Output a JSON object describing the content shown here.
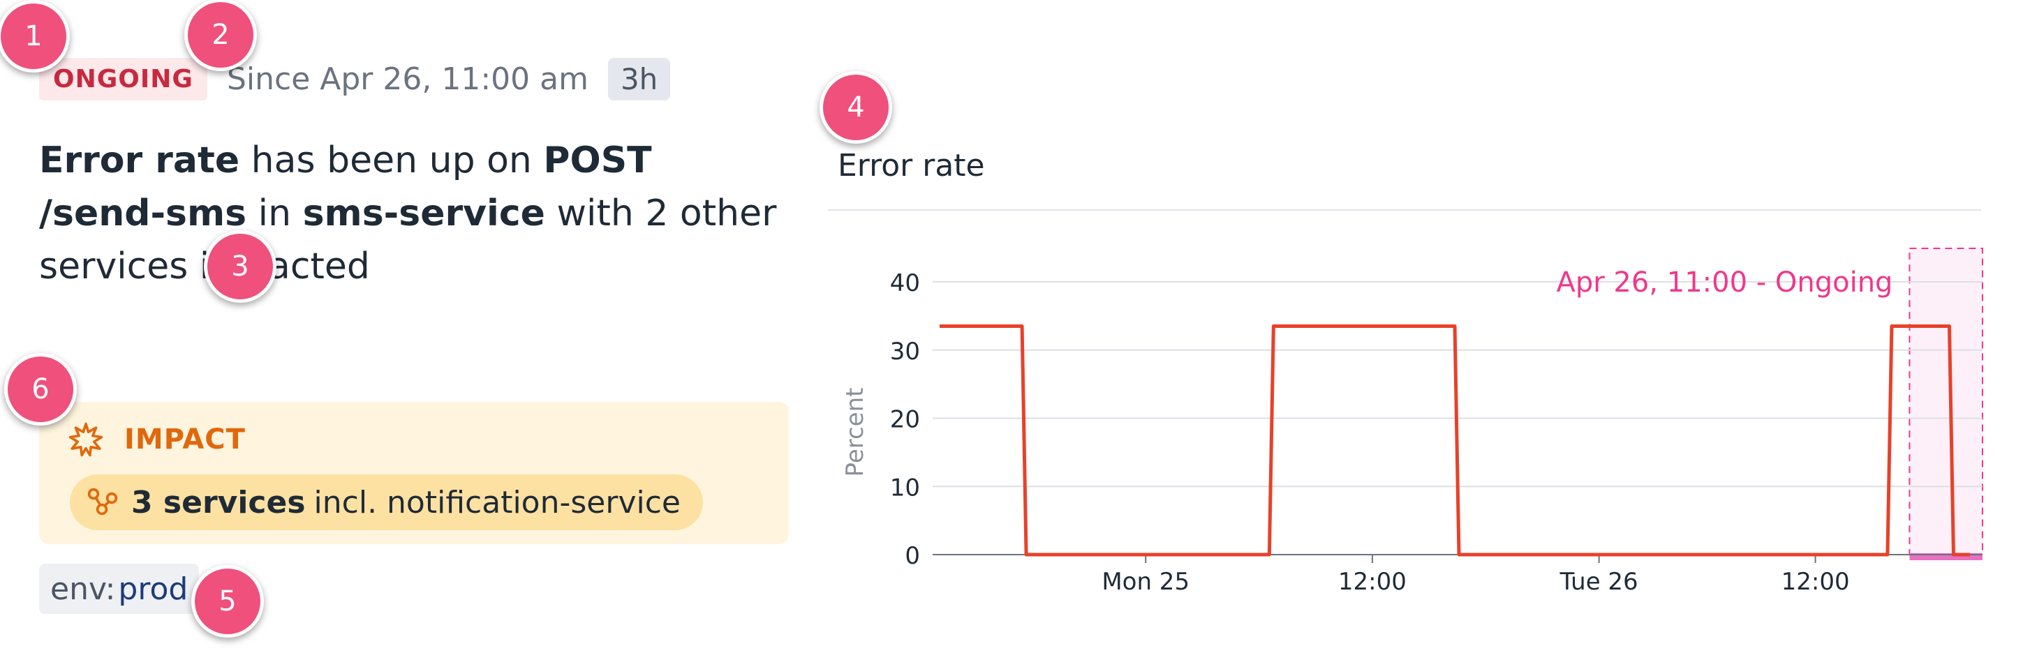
{
  "incident": {
    "status": "ONGOING",
    "since": "Since Apr 26, 11:00 am",
    "duration": "3h",
    "headline": {
      "metric": "Error rate",
      "t1": " has been up on ",
      "endpoint": "POST /send-sms",
      "t2": " in ",
      "service": "sms-service",
      "t3": " with 2 other services impacted"
    }
  },
  "impact": {
    "title": "IMPACT",
    "icon": "explosion-icon",
    "services_count": "3 services",
    "services_detail": "incl. notification-service"
  },
  "env_tag": {
    "key": "env:",
    "value": "prod"
  },
  "callouts": [
    "1",
    "2",
    "3",
    "4",
    "5",
    "6"
  ],
  "colors": {
    "series": "#e8412a",
    "annotation": "#f0378c",
    "badge": "#c8293f",
    "impact": "#e0680c"
  },
  "chart_data": {
    "type": "line",
    "title": "Error rate",
    "ylabel": "Percent",
    "ylim": [
      0,
      40
    ],
    "yticks": [
      0,
      10,
      20,
      30,
      40
    ],
    "xticks": [
      "Mon 25",
      "12:00",
      "Tue 26",
      "12:00"
    ],
    "annotation": "Apr 26, 11:00 - Ongoing",
    "grid": true,
    "series": [
      {
        "values": [
          33.5,
          33.5,
          33.5,
          33.5,
          33.5,
          0,
          0,
          0,
          0,
          0,
          0,
          0,
          0,
          0,
          0,
          0,
          0,
          33.5,
          33.5,
          33.5,
          33.5,
          33.5,
          33.5,
          33.5,
          33.5,
          33.5,
          0,
          0,
          0,
          0,
          0,
          0,
          0,
          0,
          0,
          0,
          0,
          0,
          0,
          0,
          0,
          0,
          0,
          0,
          0,
          0,
          0,
          33.5,
          33.5,
          33.5,
          0
        ]
      }
    ]
  }
}
